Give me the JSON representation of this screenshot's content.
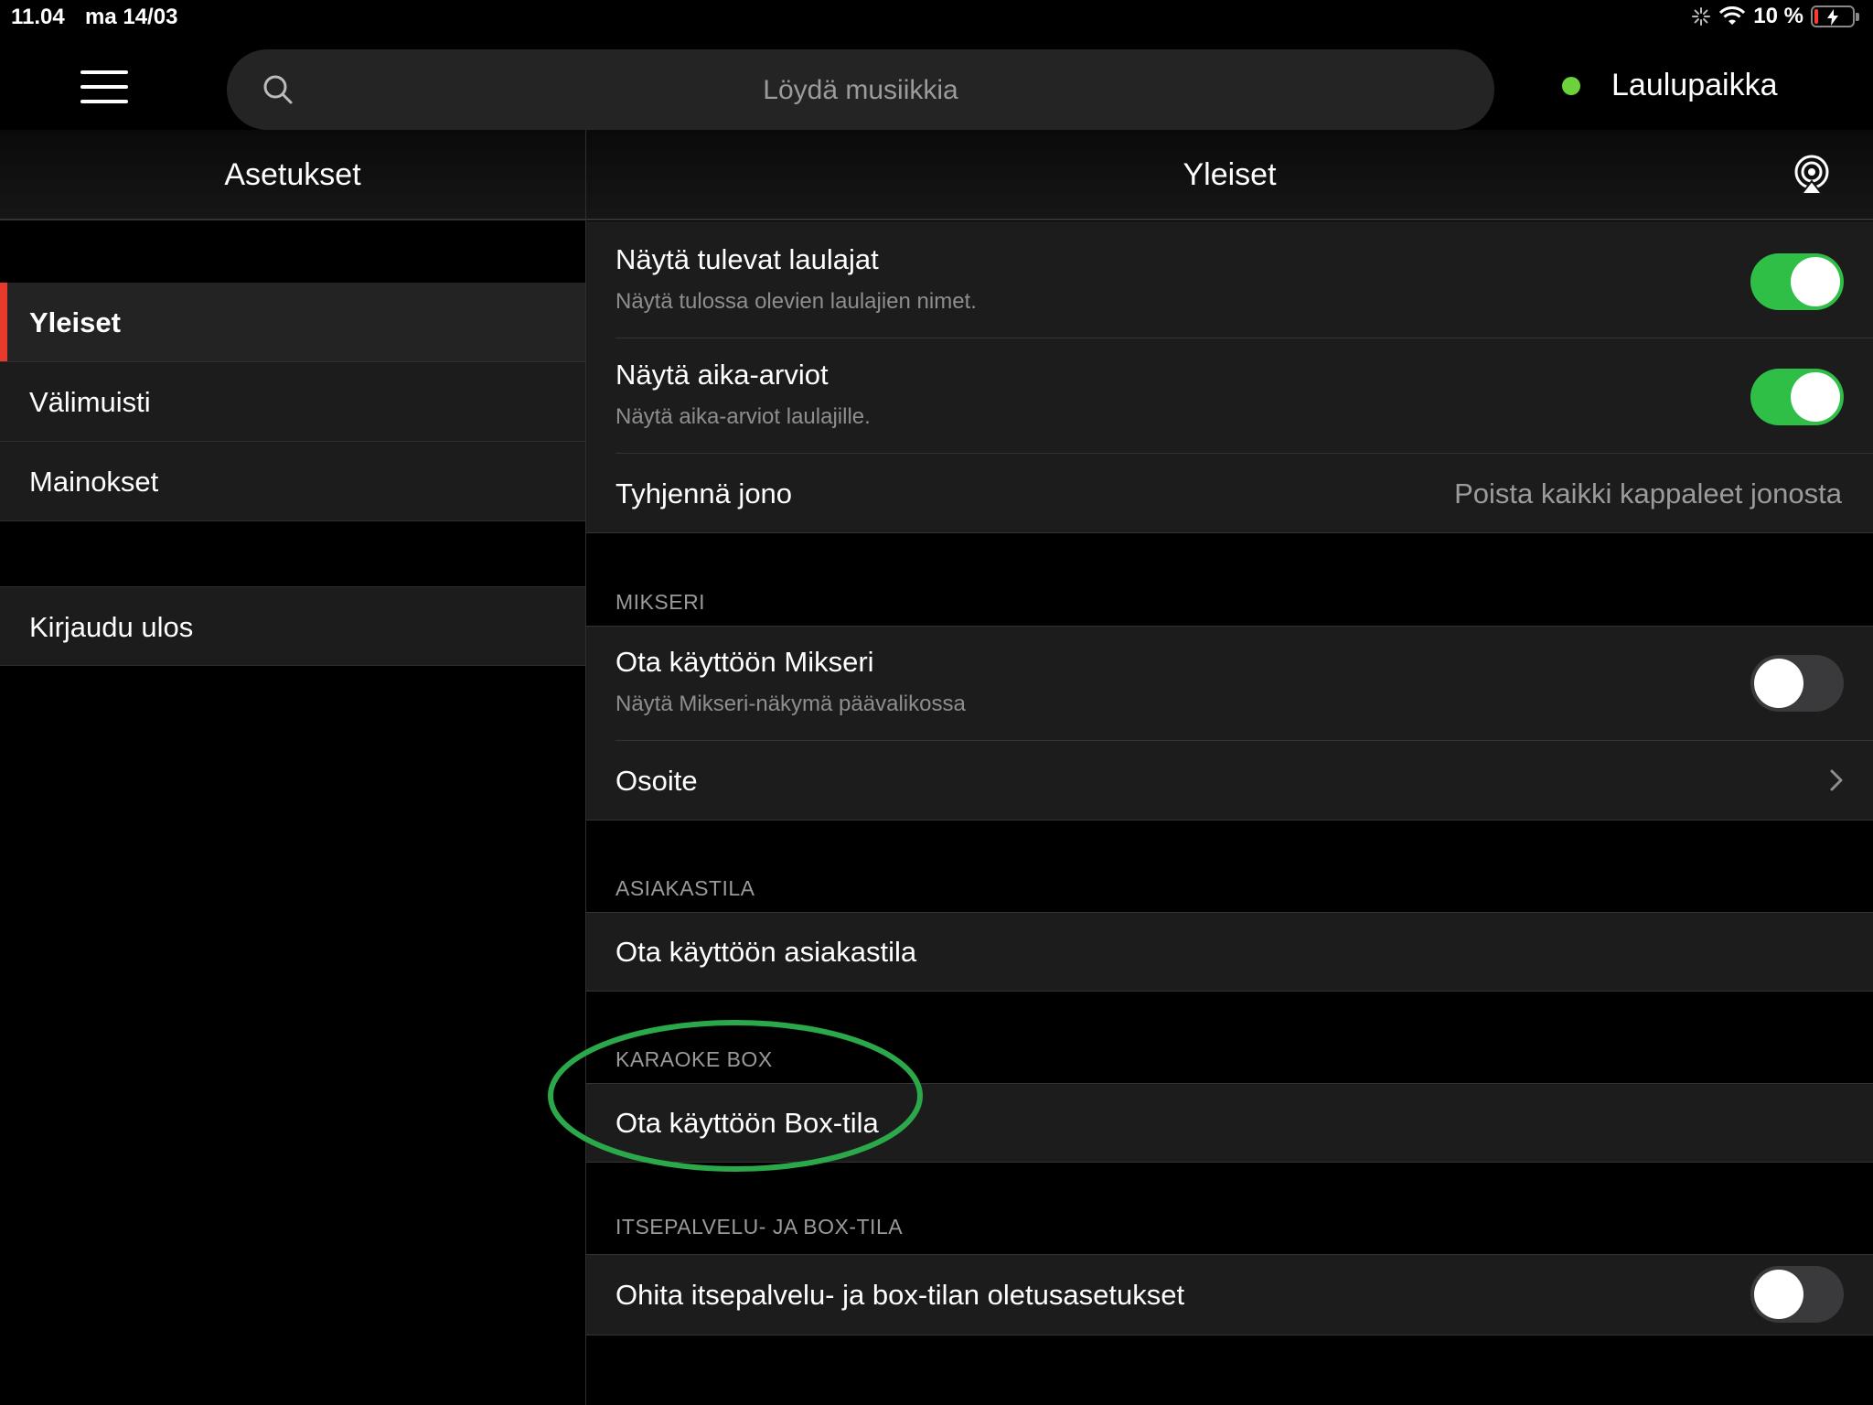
{
  "status_bar": {
    "time": "11.04",
    "date": "ma 14/03",
    "battery": "10 %",
    "battery_level": 0.1
  },
  "search": {
    "placeholder": "Löydä musiikkia"
  },
  "venue": {
    "name": "Laulupaikka",
    "status_color": "#6cd13a"
  },
  "left_header": {
    "title": "Asetukset"
  },
  "right_header": {
    "title": "Yleiset",
    "icon": "airplay-icon"
  },
  "sidebar": {
    "items": [
      {
        "label": "Yleiset",
        "active": true
      },
      {
        "label": "Välimuisti",
        "active": false
      },
      {
        "label": "Mainokset",
        "active": false
      }
    ],
    "logout": "Kirjaudu ulos",
    "active_color": "#e53a2c"
  },
  "settings": {
    "show_upcoming": {
      "title": "Näytä tulevat laulajat",
      "subtitle": "Näytä tulossa olevien laulajien nimet.",
      "enabled": true
    },
    "show_estimates": {
      "title": "Näytä aika-arviot",
      "subtitle": "Näytä aika-arviot laulajille.",
      "enabled": true
    },
    "clear_queue": {
      "title": "Tyhjennä jono",
      "action": "Poista kaikki kappaleet jonosta"
    },
    "mixer_section": "MIKSERI",
    "enable_mixer": {
      "title": "Ota käyttöön Mikseri",
      "subtitle": "Näytä Mikseri-näkymä päävalikossa",
      "enabled": false
    },
    "address": {
      "title": "Osoite"
    },
    "client_section": "ASIAKASTILA",
    "enable_client": {
      "title": "Ota käyttöön asiakastila"
    },
    "box_section": "KARAOKE BOX",
    "enable_box": {
      "title": "Ota käyttöön Box-tila"
    },
    "selfservice_section": "ITSEPALVELU- JA BOX-TILA",
    "override_defaults": {
      "title": "Ohita itsepalvelu- ja box-tilan oletusasetukset",
      "enabled": false
    }
  },
  "colors": {
    "toggle_on": "#2fbf47",
    "highlight_circle": "#2aa84a"
  }
}
